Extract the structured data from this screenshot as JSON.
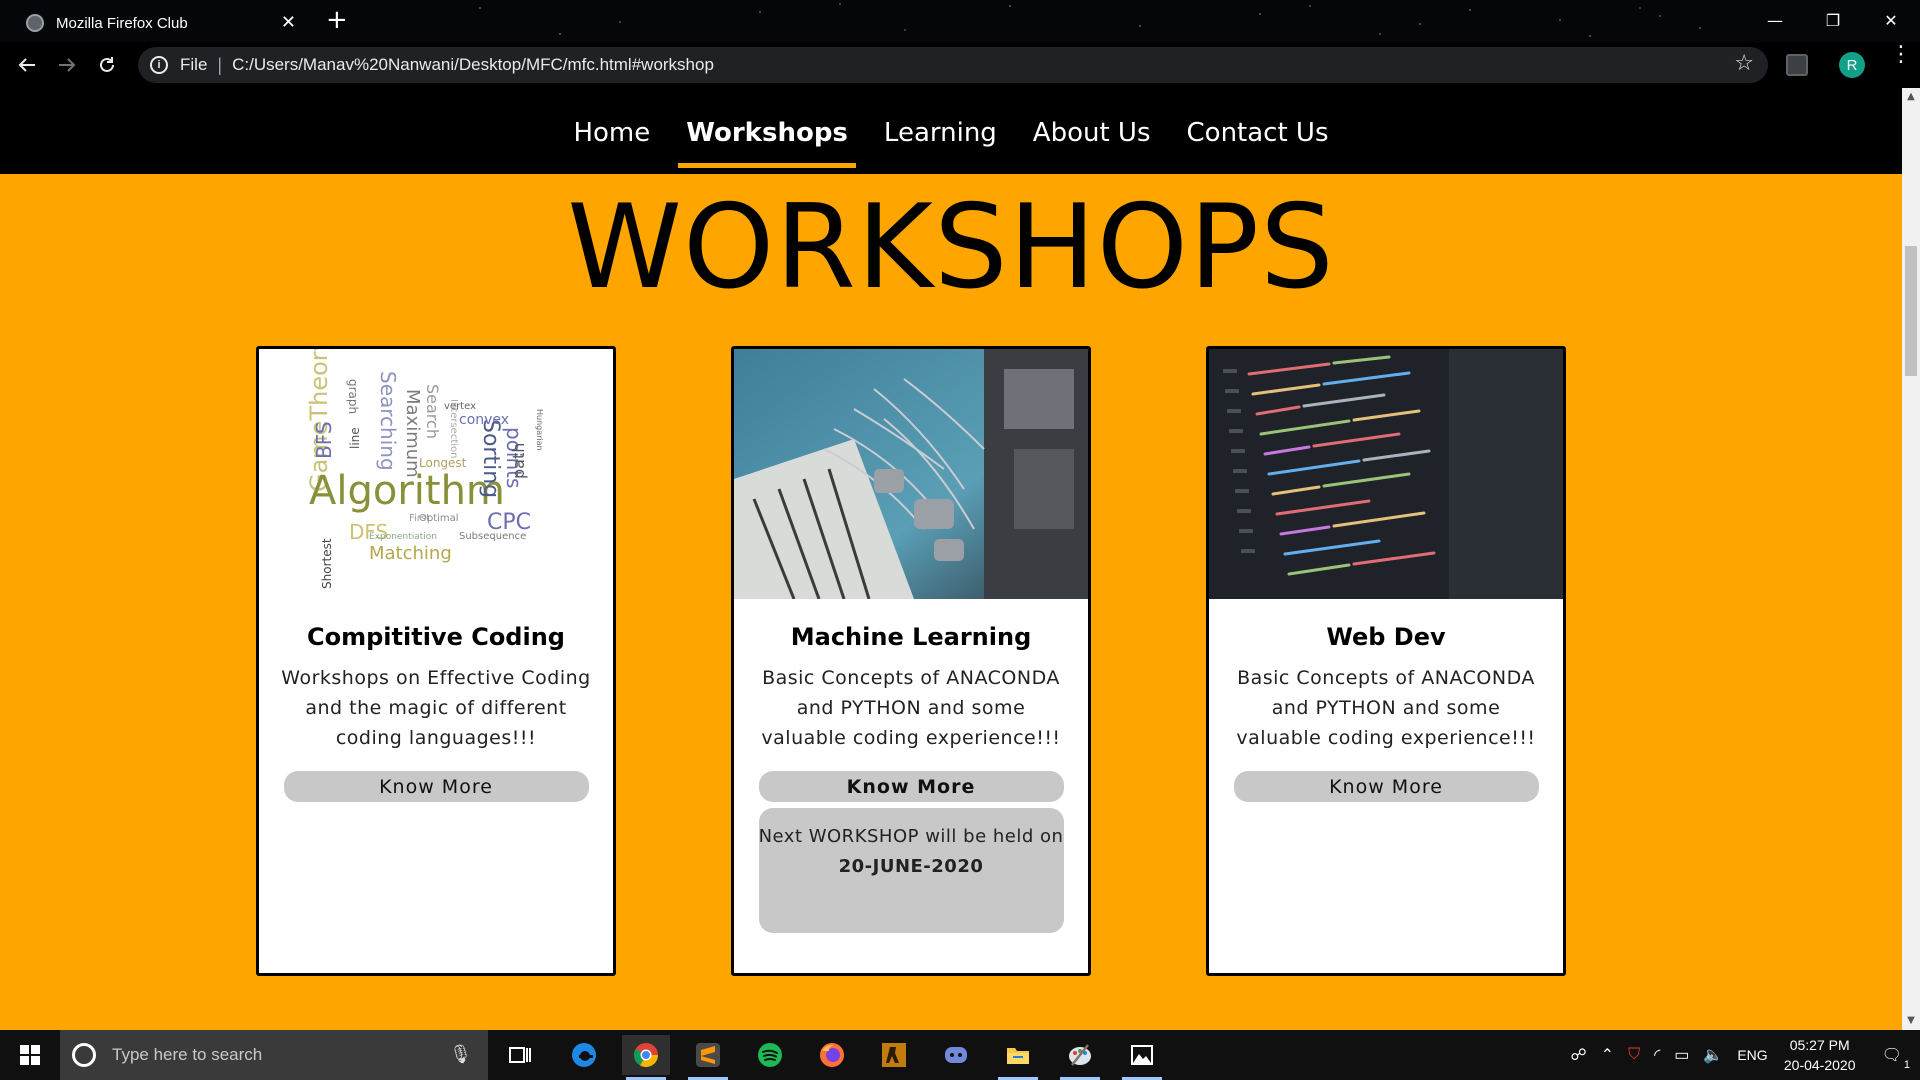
{
  "browser": {
    "tab_title": "Mozilla Firefox Club",
    "tab_close": "✕",
    "new_tab": "+",
    "url_scheme_label": "File",
    "url_separator": "|",
    "url": "C:/Users/Manav%20Nanwani/Desktop/MFC/mfc.html#workshop",
    "profile_initial": "R",
    "window_controls": [
      "—",
      "❐",
      "✕"
    ]
  },
  "site_nav": {
    "items": [
      "Home",
      "Workshops",
      "Learning",
      "About Us",
      "Contact Us"
    ],
    "active_index": 1,
    "accent_color": "#ffa500"
  },
  "page": {
    "heading": "WORKSHOPS",
    "background_color": "#ffa500"
  },
  "cards": [
    {
      "title": "Compititive Coding",
      "description": "Workshops on Effective Coding and the magic of different coding languages!!!",
      "button": "Know More",
      "image": "algorithm-word-cloud"
    },
    {
      "title": "Machine Learning",
      "description": "Basic Concepts of ANACONDA and PYTHON and some valuable coding experience!!!",
      "button": "Know More",
      "image": "robot-hands-playing-piano",
      "notice_text": "Next WORKSHOP will be held on",
      "notice_date": "20-JUNE-2020"
    },
    {
      "title": "Web Dev",
      "description": "Basic Concepts of ANACONDA and PYTHON and some valuable coding experience!!!",
      "button": "Know More",
      "image": "code-on-monitor"
    }
  ],
  "word_cloud": {
    "words": [
      "Algorithm",
      "GameTheory",
      "Sorting",
      "points",
      "Searching",
      "Maximum",
      "BFS",
      "CPC",
      "Matching",
      "DFS",
      "convex",
      "path",
      "Search",
      "Shortest",
      "graph",
      "line",
      "Optimal",
      "Subsequence",
      "Exponentiation",
      "Longest",
      "Hungarian",
      "vertex",
      "First",
      "Intersection"
    ]
  },
  "taskbar": {
    "search_placeholder": "Type here to search",
    "apps": [
      "edge",
      "chrome",
      "sublime",
      "spotify",
      "firefox",
      "cs",
      "discord",
      "file-explorer",
      "paint",
      "photos"
    ],
    "language": "ENG",
    "time": "05:27 PM",
    "date": "20-04-2020",
    "notification_count": "1"
  }
}
